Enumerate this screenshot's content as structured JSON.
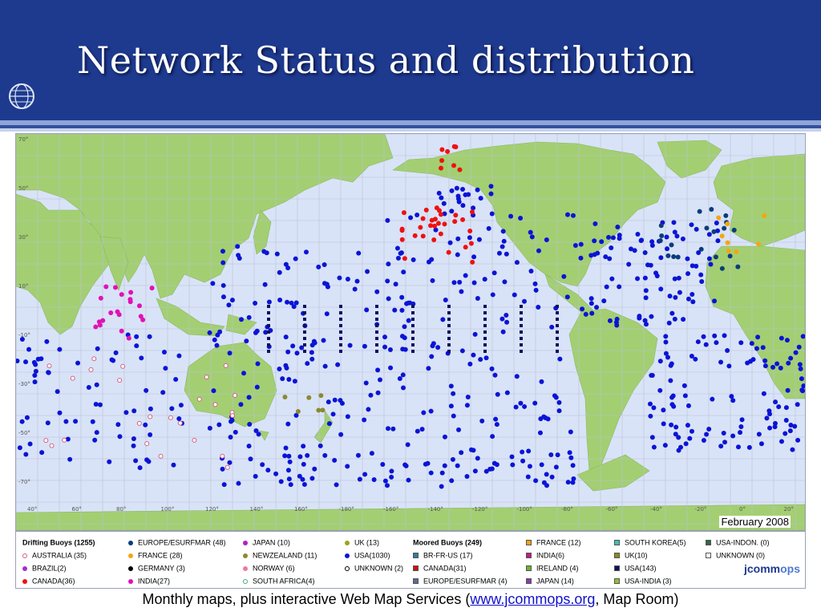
{
  "slide": {
    "title": "Network Status and distribution",
    "caption_before": "Monthly maps, plus interactive Web Map Services (",
    "caption_link": "www.jcommops.org",
    "caption_after": ", Map Room)"
  },
  "colors": {
    "header_bg": "#1e3a8f",
    "ocean": "#d9e3f7",
    "land": "#a3cf72",
    "usa_buoy": "#0a14d6",
    "canada_buoy": "#ee1111",
    "india_buoy": "#e012b5",
    "moored_usa": "#101060",
    "grid": "#b9c1d4"
  },
  "map": {
    "date_label": "February 2008",
    "longitude_labels": [
      "40°",
      "60°",
      "80°",
      "100°",
      "120°",
      "140°",
      "160°",
      "-180°",
      "-160°",
      "-140°",
      "-120°",
      "-100°",
      "-80°",
      "-60°",
      "-40°",
      "-20°",
      "0°",
      "20°"
    ],
    "latitude_labels": [
      "70°",
      "50°",
      "30°",
      "10°",
      "-10°",
      "-30°",
      "-50°",
      "-70°"
    ]
  },
  "legend": {
    "drifting_title": "Drifting Buoys (1255)",
    "moored_title": "Moored Buoys (249)",
    "logo_text_a": "jcomm",
    "logo_text_b": "ops",
    "items": [
      {
        "label": "EUROPE/ESURFMAR (48)",
        "color": "#0b3c7a",
        "shape": "circle"
      },
      {
        "label": "AUSTRALIA (35)",
        "color": "#d06080",
        "shape": "ring"
      },
      {
        "label": "BRAZIL(2)",
        "color": "#a030d0",
        "shape": "circle"
      },
      {
        "label": "CANADA(36)",
        "color": "#ee1111",
        "shape": "circle"
      },
      {
        "label": "FRANCE (28)",
        "color": "#f5a511",
        "shape": "circle"
      },
      {
        "label": "GERMANY (3)",
        "color": "#000000",
        "shape": "circle"
      },
      {
        "label": "INDIA(27)",
        "color": "#e012b5",
        "shape": "circle"
      },
      {
        "label": "JAPAN (10)",
        "color": "#b020c0",
        "shape": "circle"
      },
      {
        "label": "NEWZEALAND (11)",
        "color": "#8a8a30",
        "shape": "circle"
      },
      {
        "label": "NORWAY (6)",
        "color": "#f07aa0",
        "shape": "circle"
      },
      {
        "label": "SOUTH AFRICA(4)",
        "color": "#40b070",
        "shape": "ring"
      },
      {
        "label": "UK (13)",
        "color": "#a0a020",
        "shape": "circle"
      },
      {
        "label": "USA(1030)",
        "color": "#0a14d6",
        "shape": "circle"
      },
      {
        "label": "UNKNOWN (2)",
        "color": "#000000",
        "shape": "ring"
      },
      {
        "label": "FRANCE (12)",
        "color": "#f5a511",
        "shape": "square"
      },
      {
        "label": "BR-FR-US (17)",
        "color": "#2d7fa0",
        "shape": "square"
      },
      {
        "label": "CANADA(31)",
        "color": "#cc1111",
        "shape": "square"
      },
      {
        "label": "EUROPE/ESURFMAR (4)",
        "color": "#5a6a9a",
        "shape": "square"
      },
      {
        "label": "INDIA(6)",
        "color": "#c01890",
        "shape": "square"
      },
      {
        "label": "IRELAND (4)",
        "color": "#70b030",
        "shape": "square"
      },
      {
        "label": "JAPAN (14)",
        "color": "#8a3ab0",
        "shape": "square"
      },
      {
        "label": "SOUTH KOREA(5)",
        "color": "#40c0b0",
        "shape": "square"
      },
      {
        "label": "UK(10)",
        "color": "#8a8a20",
        "shape": "square"
      },
      {
        "label": "USA(143)",
        "color": "#101060",
        "shape": "square"
      },
      {
        "label": "USA-INDIA (3)",
        "color": "#90c030",
        "shape": "square"
      },
      {
        "label": "USA-INDON. (0)",
        "color": "#2a6a40",
        "shape": "square"
      },
      {
        "label": "UNKNOWN (0)",
        "color": "#ffffff",
        "shape": "square"
      }
    ]
  }
}
